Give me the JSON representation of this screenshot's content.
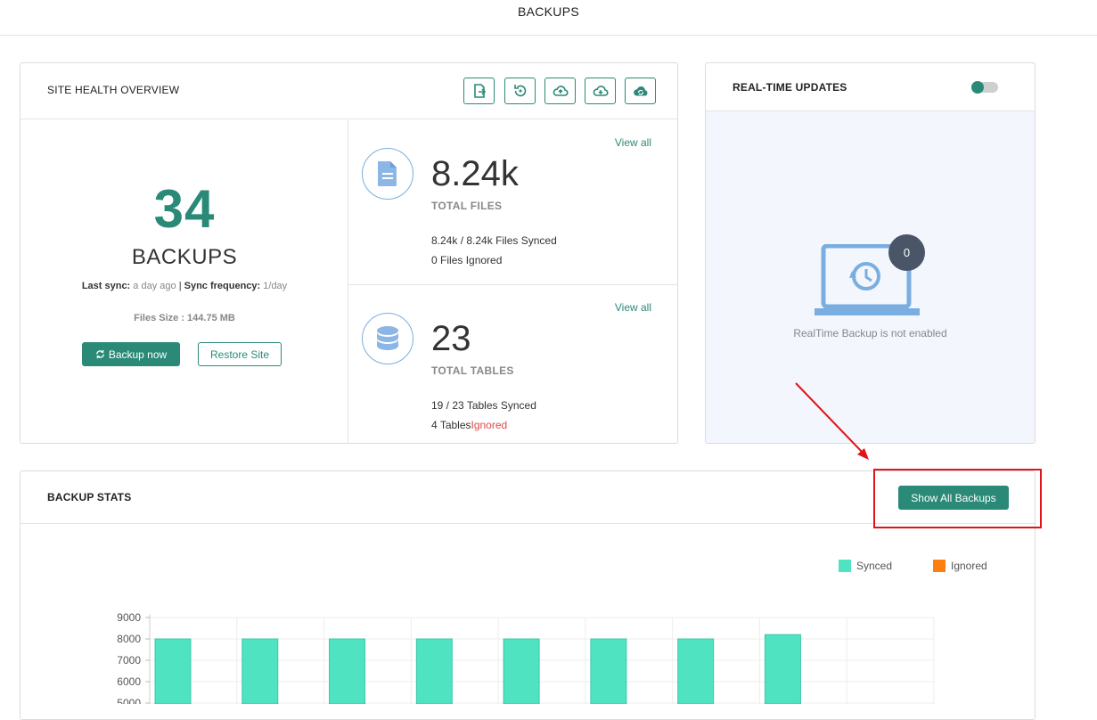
{
  "topbar": {
    "title": "BACKUPS"
  },
  "health": {
    "title": "SITE HEALTH OVERVIEW",
    "tools": [
      "export-file-icon",
      "restore-icon",
      "cloud-upload-icon",
      "cloud-download-icon",
      "cloud-sync-icon"
    ],
    "backups_count": "34",
    "backups_label": "BACKUPS",
    "last_sync_label": "Last sync:",
    "last_sync_value": "a day ago",
    "separator": "|",
    "frequency_label": "Sync frequency:",
    "frequency_value": "1/day",
    "files_size": "Files Size : 144.75 MB",
    "backup_now": "Backup now",
    "restore_site": "Restore Site",
    "files": {
      "view_all": "View all",
      "count": "8.24k",
      "label": "TOTAL FILES",
      "synced": "8.24k / 8.24k",
      "synced_suffix": "Files Synced",
      "ignored_count": "0",
      "ignored_suffix": "Files Ignored"
    },
    "tables": {
      "view_all": "View all",
      "count": "23",
      "label": "TOTAL TABLES",
      "synced": "19 / 23",
      "synced_suffix": "Tables Synced",
      "ignored_count": "4",
      "ignored_mid": "Tables",
      "ignored_suffix": "Ignored"
    }
  },
  "realtime": {
    "title": "REAL-TIME UPDATES",
    "toggle_on": false,
    "badge": "0",
    "message": "RealTime Backup is not enabled"
  },
  "stats": {
    "title": "BACKUP STATS",
    "show_all": "Show All Backups"
  },
  "colors": {
    "accent": "#2a8a77",
    "synced": "#4fe3c1",
    "ignored": "#ff7f0e",
    "highlight": "#e0151b"
  },
  "chart_data": {
    "type": "bar",
    "series": [
      {
        "name": "Synced",
        "values": [
          8000,
          8000,
          8000,
          8000,
          8000,
          8000,
          8000,
          8200
        ]
      },
      {
        "name": "Ignored",
        "values": []
      }
    ],
    "yticks": [
      "9000",
      "8000",
      "7000",
      "6000",
      "5000"
    ],
    "ylim": [
      5000,
      9000
    ],
    "legend": "top-right",
    "grid": true
  }
}
